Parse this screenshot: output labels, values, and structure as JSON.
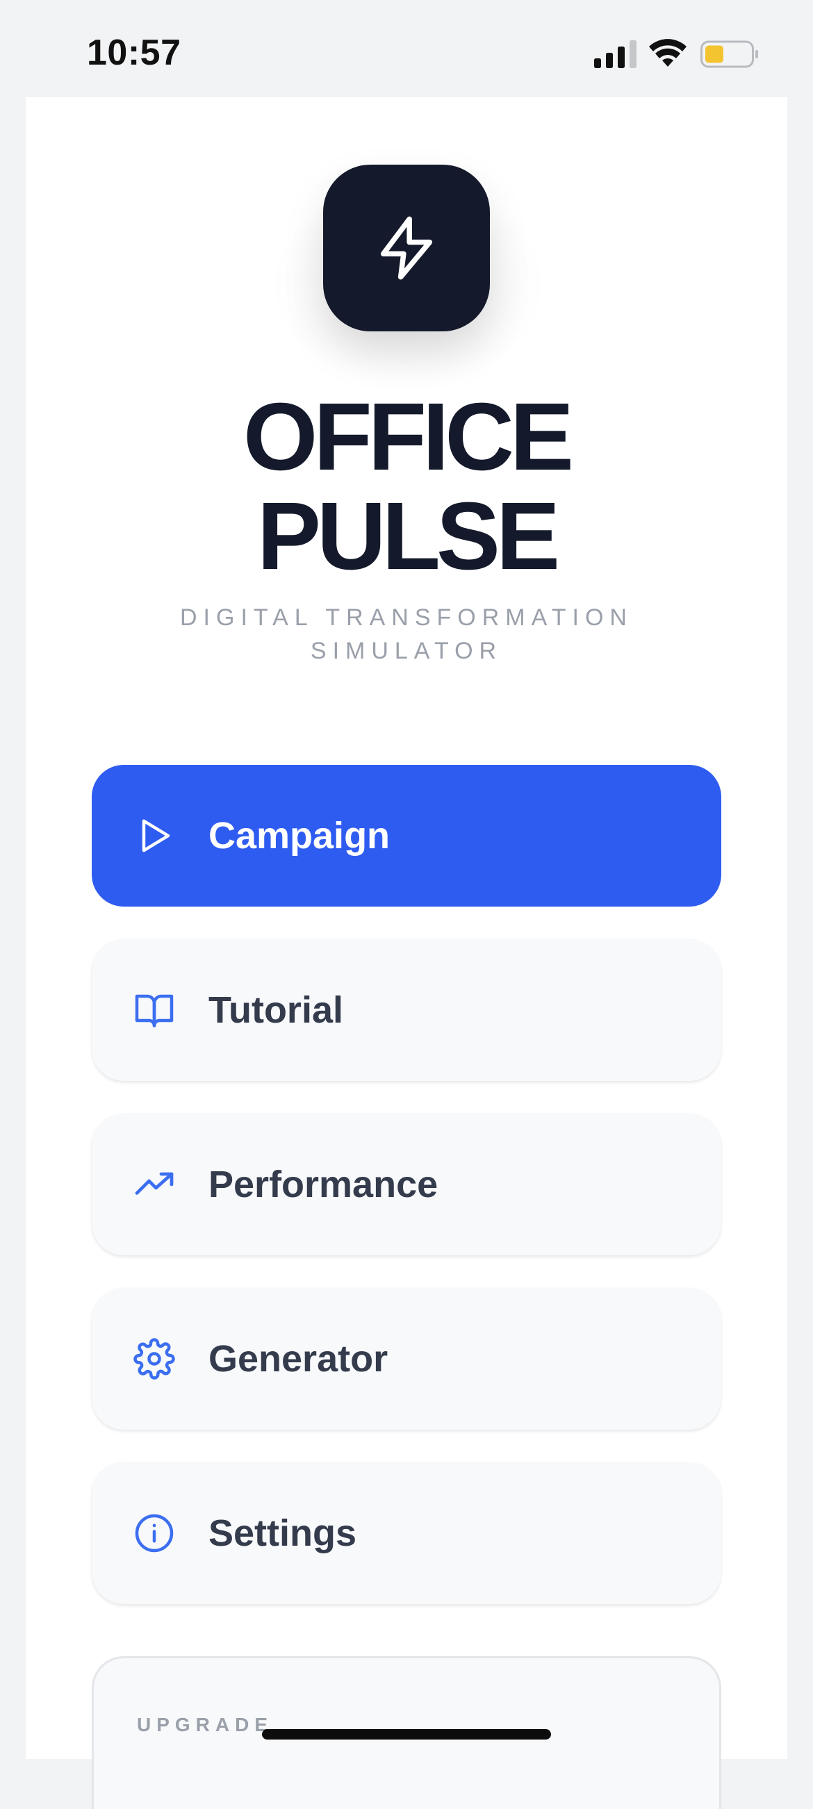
{
  "status_bar": {
    "time": "10:57",
    "signal_icon": "cellular-signal-icon",
    "wifi_icon": "wifi-icon",
    "battery_icon": "battery-low-icon",
    "battery_color": "#f4c430"
  },
  "app": {
    "logo_icon": "lightning-bolt-icon",
    "title_line1": "OFFICE",
    "title_line2": "PULSE",
    "subtitle_line1": "DIGITAL TRANSFORMATION",
    "subtitle_line2": "SIMULATOR"
  },
  "menu": {
    "items": [
      {
        "label": "Campaign",
        "icon": "play-icon",
        "primary": true
      },
      {
        "label": "Tutorial",
        "icon": "book-icon",
        "primary": false
      },
      {
        "label": "Performance",
        "icon": "trending-up-icon",
        "primary": false
      },
      {
        "label": "Generator",
        "icon": "gear-icon",
        "primary": false
      },
      {
        "label": "Settings",
        "icon": "info-icon",
        "primary": false
      }
    ]
  },
  "upgrade": {
    "label": "UPGRADE"
  },
  "colors": {
    "accent": "#2f5cf0",
    "icon_accent": "#3b6ef0",
    "dark": "#141a2b",
    "muted": "#9aa0aa"
  }
}
